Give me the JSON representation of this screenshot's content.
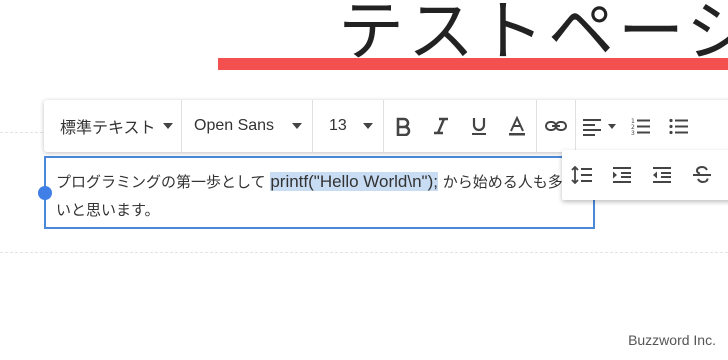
{
  "page": {
    "title": "テストページ",
    "underline_color": "#f55050"
  },
  "toolbar": {
    "format_select": "標準テキスト",
    "font_select": "Open Sans",
    "size_select": "13",
    "icons": [
      "bold-icon",
      "italic-icon",
      "underline-icon",
      "text-color-icon",
      "link-icon",
      "align-left-icon",
      "numbered-list-icon",
      "bulleted-list-icon"
    ]
  },
  "toolbar_secondary": {
    "icons": [
      "line-height-icon",
      "indent-icon",
      "outdent-icon",
      "strikethrough-icon"
    ]
  },
  "editor": {
    "text_before": "プログラミングの第一歩として ",
    "selected_text": "printf(\"Hello World\\n\");",
    "text_after": " から始める人も多いと思います。",
    "border_color": "#4a88d8",
    "selection_color": "#c8dcf3"
  },
  "footer": {
    "brand": "Buzzword Inc."
  }
}
